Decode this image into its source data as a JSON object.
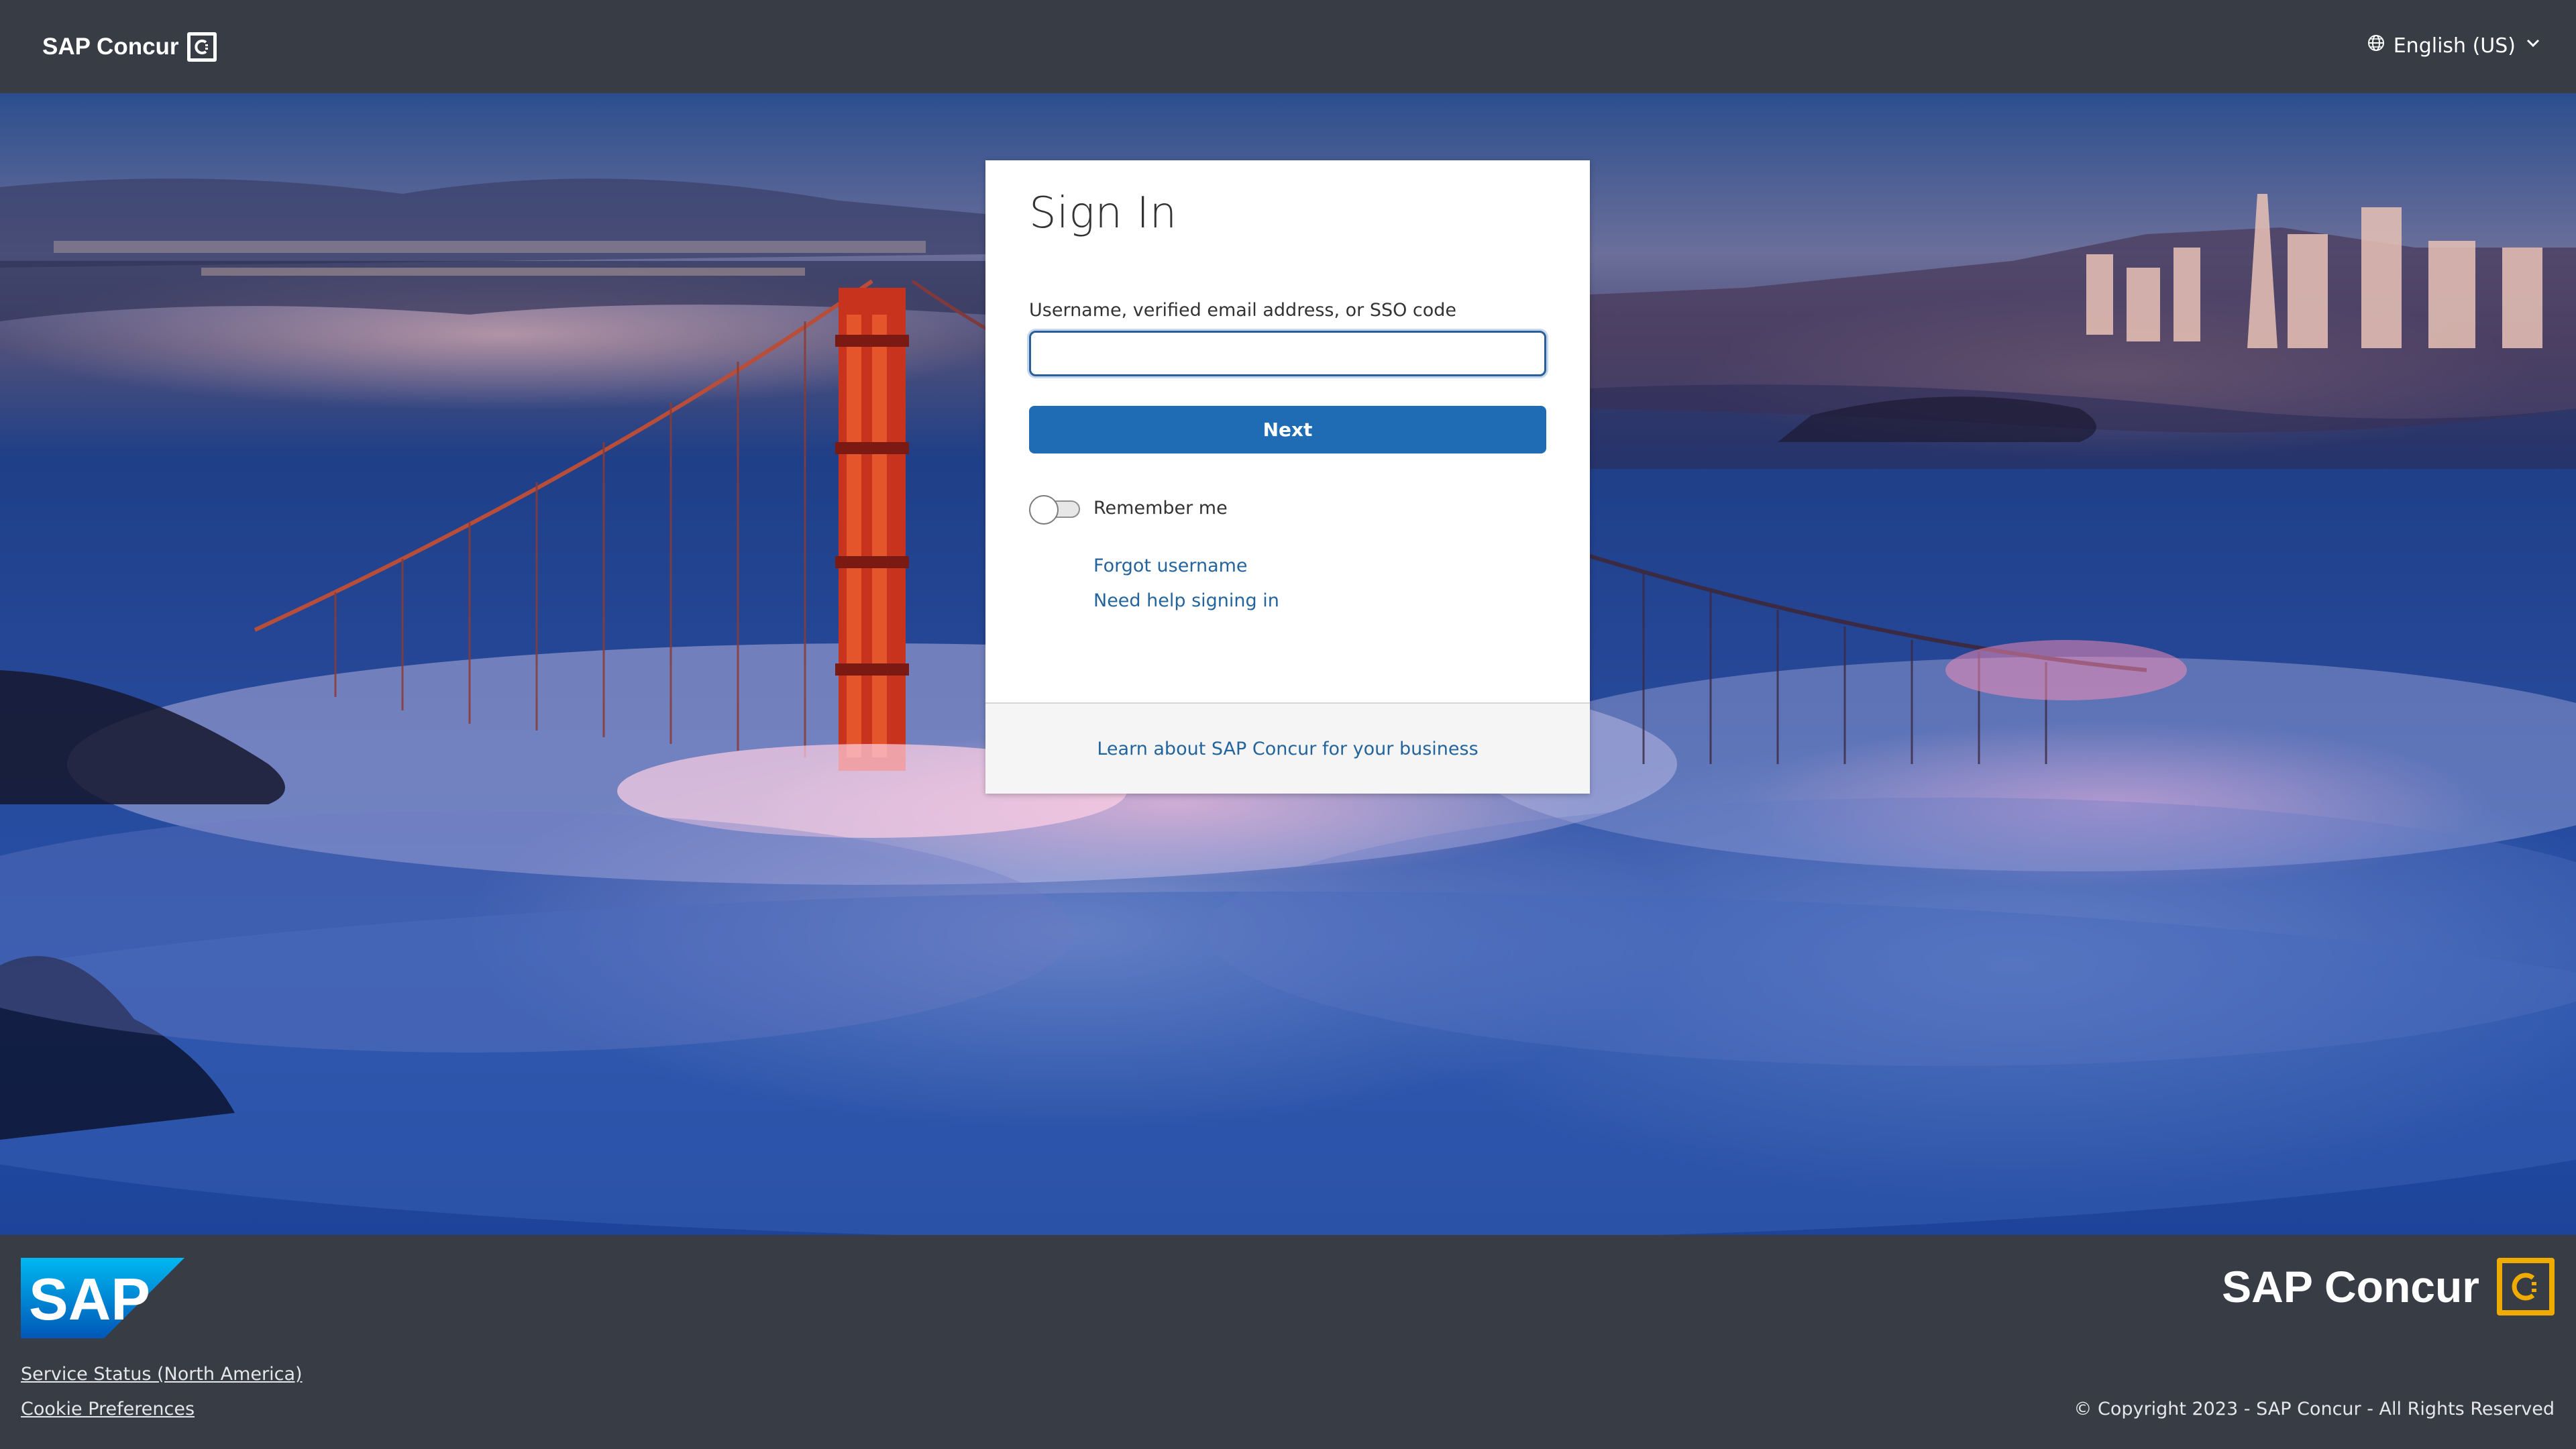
{
  "header": {
    "brand": "SAP Concur",
    "brand_icon": "concur-c-icon",
    "language": "English (US)",
    "language_icon": "globe-icon",
    "language_caret_icon": "chevron-down-icon"
  },
  "signin": {
    "title": "Sign In",
    "username_label": "Username, verified email address, or SSO code",
    "username_value": "",
    "next_label": "Next",
    "remember_label": "Remember me",
    "remember_checked": false,
    "forgot_username": "Forgot username",
    "need_help": "Need help signing in",
    "learn_more": "Learn about SAP Concur for your business"
  },
  "footer": {
    "sap_logo_text": "SAP",
    "concur_logo_text": "SAP Concur",
    "service_status": "Service Status (North America)",
    "cookie_preferences": "Cookie Preferences",
    "copyright": "© Copyright 2023 - SAP Concur - All Rights Reserved"
  },
  "colors": {
    "header_bg": "#373c45",
    "primary_button": "#1f6cb5",
    "link": "#23649d",
    "concur_accent": "#f0ab00",
    "sap_blue": "#008fd3"
  }
}
